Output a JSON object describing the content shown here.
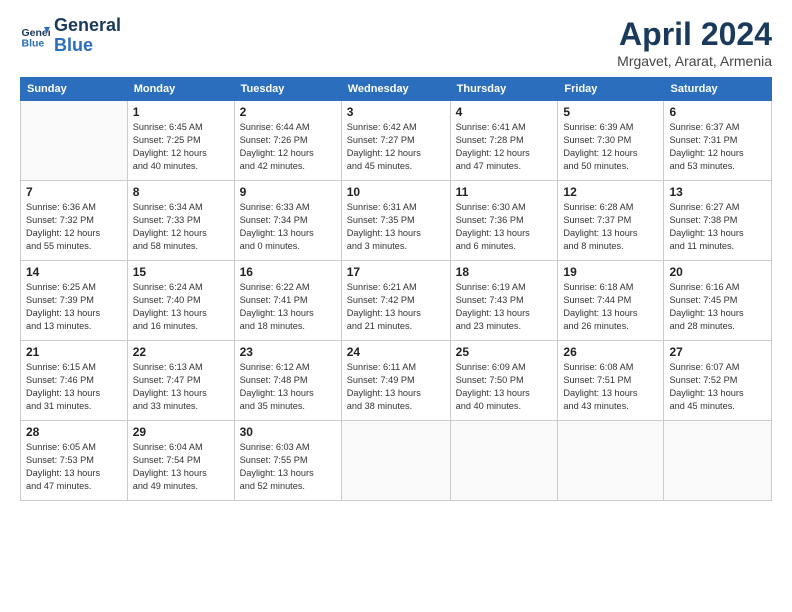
{
  "header": {
    "logo_line1": "General",
    "logo_line2": "Blue",
    "title": "April 2024",
    "location": "Mrgavet, Ararat, Armenia"
  },
  "weekdays": [
    "Sunday",
    "Monday",
    "Tuesday",
    "Wednesday",
    "Thursday",
    "Friday",
    "Saturday"
  ],
  "weeks": [
    [
      {
        "day": "",
        "info": ""
      },
      {
        "day": "1",
        "info": "Sunrise: 6:45 AM\nSunset: 7:25 PM\nDaylight: 12 hours\nand 40 minutes."
      },
      {
        "day": "2",
        "info": "Sunrise: 6:44 AM\nSunset: 7:26 PM\nDaylight: 12 hours\nand 42 minutes."
      },
      {
        "day": "3",
        "info": "Sunrise: 6:42 AM\nSunset: 7:27 PM\nDaylight: 12 hours\nand 45 minutes."
      },
      {
        "day": "4",
        "info": "Sunrise: 6:41 AM\nSunset: 7:28 PM\nDaylight: 12 hours\nand 47 minutes."
      },
      {
        "day": "5",
        "info": "Sunrise: 6:39 AM\nSunset: 7:30 PM\nDaylight: 12 hours\nand 50 minutes."
      },
      {
        "day": "6",
        "info": "Sunrise: 6:37 AM\nSunset: 7:31 PM\nDaylight: 12 hours\nand 53 minutes."
      }
    ],
    [
      {
        "day": "7",
        "info": "Sunrise: 6:36 AM\nSunset: 7:32 PM\nDaylight: 12 hours\nand 55 minutes."
      },
      {
        "day": "8",
        "info": "Sunrise: 6:34 AM\nSunset: 7:33 PM\nDaylight: 12 hours\nand 58 minutes."
      },
      {
        "day": "9",
        "info": "Sunrise: 6:33 AM\nSunset: 7:34 PM\nDaylight: 13 hours\nand 0 minutes."
      },
      {
        "day": "10",
        "info": "Sunrise: 6:31 AM\nSunset: 7:35 PM\nDaylight: 13 hours\nand 3 minutes."
      },
      {
        "day": "11",
        "info": "Sunrise: 6:30 AM\nSunset: 7:36 PM\nDaylight: 13 hours\nand 6 minutes."
      },
      {
        "day": "12",
        "info": "Sunrise: 6:28 AM\nSunset: 7:37 PM\nDaylight: 13 hours\nand 8 minutes."
      },
      {
        "day": "13",
        "info": "Sunrise: 6:27 AM\nSunset: 7:38 PM\nDaylight: 13 hours\nand 11 minutes."
      }
    ],
    [
      {
        "day": "14",
        "info": "Sunrise: 6:25 AM\nSunset: 7:39 PM\nDaylight: 13 hours\nand 13 minutes."
      },
      {
        "day": "15",
        "info": "Sunrise: 6:24 AM\nSunset: 7:40 PM\nDaylight: 13 hours\nand 16 minutes."
      },
      {
        "day": "16",
        "info": "Sunrise: 6:22 AM\nSunset: 7:41 PM\nDaylight: 13 hours\nand 18 minutes."
      },
      {
        "day": "17",
        "info": "Sunrise: 6:21 AM\nSunset: 7:42 PM\nDaylight: 13 hours\nand 21 minutes."
      },
      {
        "day": "18",
        "info": "Sunrise: 6:19 AM\nSunset: 7:43 PM\nDaylight: 13 hours\nand 23 minutes."
      },
      {
        "day": "19",
        "info": "Sunrise: 6:18 AM\nSunset: 7:44 PM\nDaylight: 13 hours\nand 26 minutes."
      },
      {
        "day": "20",
        "info": "Sunrise: 6:16 AM\nSunset: 7:45 PM\nDaylight: 13 hours\nand 28 minutes."
      }
    ],
    [
      {
        "day": "21",
        "info": "Sunrise: 6:15 AM\nSunset: 7:46 PM\nDaylight: 13 hours\nand 31 minutes."
      },
      {
        "day": "22",
        "info": "Sunrise: 6:13 AM\nSunset: 7:47 PM\nDaylight: 13 hours\nand 33 minutes."
      },
      {
        "day": "23",
        "info": "Sunrise: 6:12 AM\nSunset: 7:48 PM\nDaylight: 13 hours\nand 35 minutes."
      },
      {
        "day": "24",
        "info": "Sunrise: 6:11 AM\nSunset: 7:49 PM\nDaylight: 13 hours\nand 38 minutes."
      },
      {
        "day": "25",
        "info": "Sunrise: 6:09 AM\nSunset: 7:50 PM\nDaylight: 13 hours\nand 40 minutes."
      },
      {
        "day": "26",
        "info": "Sunrise: 6:08 AM\nSunset: 7:51 PM\nDaylight: 13 hours\nand 43 minutes."
      },
      {
        "day": "27",
        "info": "Sunrise: 6:07 AM\nSunset: 7:52 PM\nDaylight: 13 hours\nand 45 minutes."
      }
    ],
    [
      {
        "day": "28",
        "info": "Sunrise: 6:05 AM\nSunset: 7:53 PM\nDaylight: 13 hours\nand 47 minutes."
      },
      {
        "day": "29",
        "info": "Sunrise: 6:04 AM\nSunset: 7:54 PM\nDaylight: 13 hours\nand 49 minutes."
      },
      {
        "day": "30",
        "info": "Sunrise: 6:03 AM\nSunset: 7:55 PM\nDaylight: 13 hours\nand 52 minutes."
      },
      {
        "day": "",
        "info": ""
      },
      {
        "day": "",
        "info": ""
      },
      {
        "day": "",
        "info": ""
      },
      {
        "day": "",
        "info": ""
      }
    ]
  ]
}
